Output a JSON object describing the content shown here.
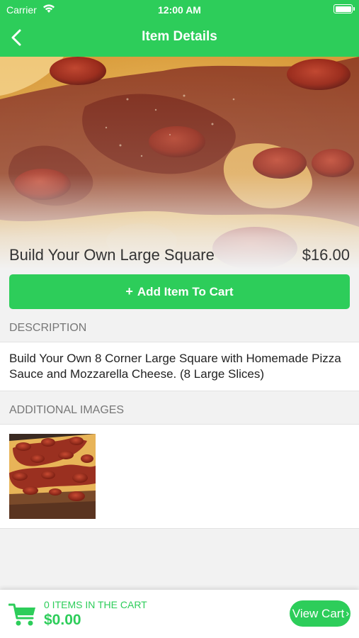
{
  "status_bar": {
    "carrier": "Carrier",
    "time": "12:00 AM"
  },
  "nav": {
    "title": "Item Details",
    "back_icon": "chevron-left-icon"
  },
  "item": {
    "name": "Build Your Own Large Square",
    "price": "$16.00"
  },
  "add_button": {
    "plus": "+",
    "label": "Add Item To Cart"
  },
  "description": {
    "header": "DESCRIPTION",
    "text": "Build Your Own 8 Corner Large Square with Homemade Pizza Sauce and Mozzarella Cheese. (8 Large Slices)"
  },
  "additional_images": {
    "header": "ADDITIONAL IMAGES"
  },
  "cart": {
    "count_text": "0 ITEMS IN THE CART",
    "total": "$0.00",
    "view_cart_label": "View Cart",
    "view_cart_chevron": "›",
    "icon": "shopping-cart-icon"
  },
  "colors": {
    "accent": "#2dcd5a",
    "section_bg": "#f2f2f2",
    "text": "#333333"
  }
}
